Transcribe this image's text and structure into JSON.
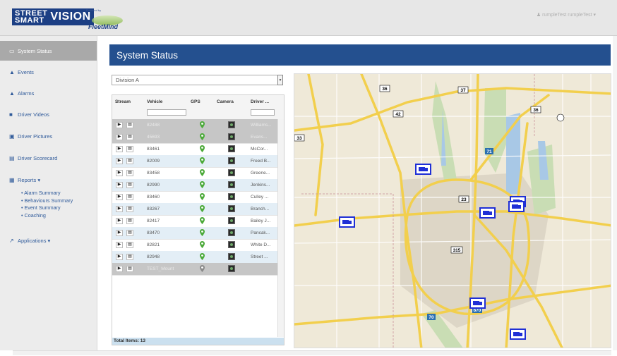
{
  "header": {
    "logo_street": "STREET",
    "logo_smart": "SMART",
    "logo_vision": "VISION",
    "logo_sub": "BY BUSWURX",
    "powered_by": "Powered by",
    "fleetmind": "FleetMind",
    "user_menu": "rumpleTest rumpleTest ▾"
  },
  "sidebar": {
    "items": [
      {
        "label": "System Status",
        "icon": "monitor-icon"
      },
      {
        "label": "Events",
        "icon": "warning-icon"
      },
      {
        "label": "Alarms",
        "icon": "bell-icon"
      },
      {
        "label": "Driver Videos",
        "icon": "video-icon"
      },
      {
        "label": "Driver Pictures",
        "icon": "picture-icon"
      },
      {
        "label": "Driver Scorecard",
        "icon": "scorecard-icon"
      },
      {
        "label": "Reports ▾",
        "icon": "reports-icon"
      },
      {
        "label": "Applications ▾",
        "icon": "external-link-icon"
      }
    ],
    "reports_sub": [
      "• Alarm Summary",
      "• Behaviours Summary",
      "• Event Summary",
      "• Coaching"
    ]
  },
  "main": {
    "title": "System Status",
    "division": "Division A",
    "columns": [
      "Stream",
      "Vehicle",
      "GPS",
      "Camera",
      "Driver ..."
    ],
    "rows": [
      {
        "vehicle": "82488",
        "driver": "Williams..."
      },
      {
        "vehicle": "45693",
        "driver": "Evans..."
      },
      {
        "vehicle": "83461",
        "driver": "McCor..."
      },
      {
        "vehicle": "82009",
        "driver": "Freed B..."
      },
      {
        "vehicle": "83458",
        "driver": "Greene..."
      },
      {
        "vehicle": "82990",
        "driver": "Jenkins..."
      },
      {
        "vehicle": "83460",
        "driver": "Culley ..."
      },
      {
        "vehicle": "83267",
        "driver": "Branch..."
      },
      {
        "vehicle": "82417",
        "driver": "Bailey J..."
      },
      {
        "vehicle": "83470",
        "driver": "Pancak..."
      },
      {
        "vehicle": "82821",
        "driver": "White D..."
      },
      {
        "vehicle": "82948",
        "driver": "Street ..."
      },
      {
        "vehicle": "TEST_Mount",
        "driver": ""
      }
    ],
    "total": "Total Items: 13"
  },
  "map": {
    "route_labels": [
      "36",
      "37",
      "42",
      "33",
      "36",
      "23",
      "71",
      "315",
      "70",
      "670"
    ]
  },
  "colors": {
    "title_bar": "#24508f",
    "link": "#2f5a9a",
    "row_alt": "#e3eef6",
    "vehicle_marker": "#1f2fd6"
  }
}
